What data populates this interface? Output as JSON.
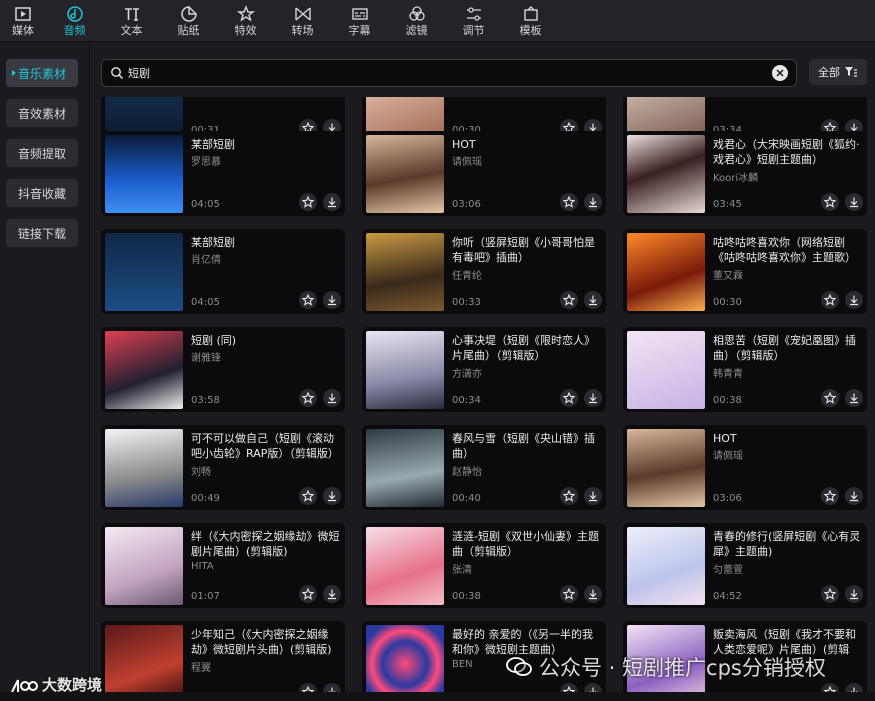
{
  "toolbar": {
    "tabs": [
      {
        "label": "媒体",
        "icon": "media-icon"
      },
      {
        "label": "音频",
        "icon": "audio-icon",
        "active": true
      },
      {
        "label": "文本",
        "icon": "text-icon"
      },
      {
        "label": "贴纸",
        "icon": "sticker-icon"
      },
      {
        "label": "特效",
        "icon": "effects-icon"
      },
      {
        "label": "转场",
        "icon": "transition-icon"
      },
      {
        "label": "字幕",
        "icon": "subtitle-icon"
      },
      {
        "label": "滤镜",
        "icon": "filter-icon"
      },
      {
        "label": "调节",
        "icon": "adjust-icon"
      },
      {
        "label": "模板",
        "icon": "template-icon"
      }
    ],
    "accent": "#22c6d8"
  },
  "sidebar": {
    "items": [
      {
        "label": "音乐素材",
        "active": true
      },
      {
        "label": "音效素材"
      },
      {
        "label": "音频提取"
      },
      {
        "label": "抖音收藏"
      },
      {
        "label": "链接下载"
      }
    ]
  },
  "search": {
    "query": "短剧",
    "filter_label": "全部"
  },
  "results": [
    {
      "title": "",
      "artist": "",
      "duration": "00:31"
    },
    {
      "title": "",
      "artist": "",
      "duration": "00:30"
    },
    {
      "title": "",
      "artist": "",
      "duration": "03:34"
    },
    {
      "title": "某部短剧",
      "artist": "罗思慕",
      "duration": "04:05"
    },
    {
      "title": "HOT",
      "artist": "请佩瑶",
      "duration": "03:06"
    },
    {
      "title": "戏君心（大宋映画短剧《狐约·戏君心》短剧主题曲）",
      "artist": "Koori冰麟",
      "duration": "03:45"
    },
    {
      "title": "某部短剧",
      "artist": "肖亿倩",
      "duration": "04:05"
    },
    {
      "title": "你听（竖屏短剧《小哥哥怕是有毒吧》插曲）",
      "artist": "任青纶",
      "duration": "00:33"
    },
    {
      "title": "咕咚咕咚喜欢你（网络短剧《咕咚咕咚喜欢你》主题歌）(…",
      "artist": "董又霖",
      "duration": "00:30"
    },
    {
      "title": "短剧 (同)",
      "artist": "谢雅锋",
      "duration": "03:58"
    },
    {
      "title": "心事决堤（短剧《限时恋人》片尾曲）（剪辑版）",
      "artist": "方潇亦",
      "duration": "00:34"
    },
    {
      "title": "相思苦（短剧《宠妃凰图》插曲）（剪辑版）",
      "artist": "韩青青",
      "duration": "00:38"
    },
    {
      "title": "可不可以做自己（短剧《滚动吧小齿轮》RAP版）（剪辑版）",
      "artist": "刘畅",
      "duration": "00:49"
    },
    {
      "title": "春风与雪（短剧《央山错》插曲）",
      "artist": "赵静怡",
      "duration": "00:40"
    },
    {
      "title": "HOT",
      "artist": "请佩瑶",
      "duration": "03:06"
    },
    {
      "title": "绊（《大内密探之姻缘劫》微短剧片尾曲）(剪辑版)",
      "artist": "HITA",
      "duration": "01:07"
    },
    {
      "title": "涟涟-短剧《双世小仙妻》主题曲（剪辑版）",
      "artist": "张清",
      "duration": "00:38"
    },
    {
      "title": "青春的修行(竖屏短剧《心有灵犀》主题曲)",
      "artist": "匀蕾萱",
      "duration": "04:52"
    },
    {
      "title": "少年知己（《大内密探之姻缘劫》微短剧片头曲）(剪辑版)",
      "artist": "程翼",
      "duration": ""
    },
    {
      "title": "最好的 亲爱的（《另一半的我和你》微短剧主题曲）",
      "artist": "BEN",
      "duration": ""
    },
    {
      "title": "贩卖海风（短剧《我才不要和人类恋爱呢》片尾曲）(剪辑版)",
      "artist": "",
      "duration": ""
    }
  ],
  "watermarks": {
    "left": "大数跨境",
    "right": "公众号 · 短剧推广cps分销授权"
  }
}
